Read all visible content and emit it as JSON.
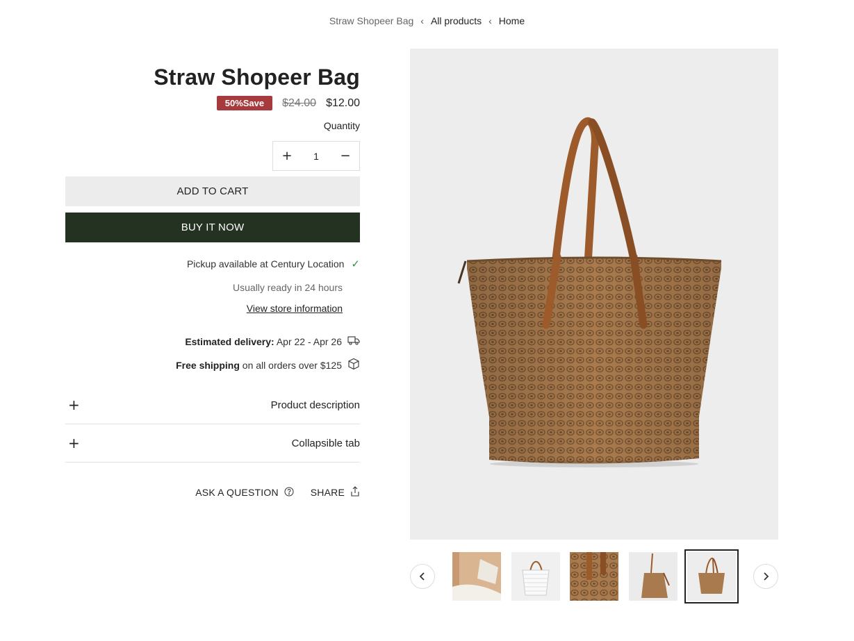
{
  "breadcrumb": {
    "current": "Straw Shopeer Bag",
    "items": [
      "All products",
      "Home"
    ],
    "separator": "‹"
  },
  "product": {
    "title": "Straw Shopeer Bag",
    "badge": "50%Save",
    "price_old": "$24.00",
    "price_new": "$12.00"
  },
  "quantity": {
    "label": "Quantity",
    "value": "1",
    "plus": "+",
    "minus": "−"
  },
  "buttons": {
    "add_to_cart": "ADD TO CART",
    "buy_now": "BUY IT NOW"
  },
  "pickup": {
    "text": "Pickup available at Century Location",
    "ready": "Usually ready in 24 hours",
    "link": "View store information"
  },
  "delivery": {
    "label": "Estimated delivery:",
    "range": "Apr 22 - Apr 26"
  },
  "shipping": {
    "label": "Free shipping",
    "text": "on all orders over $125"
  },
  "accordion": [
    {
      "label": "Product description",
      "icon": "+"
    },
    {
      "label": "Collapsible tab",
      "icon": "+"
    }
  ],
  "actions": {
    "ask": "ASK A QUESTION",
    "share": "SHARE"
  },
  "colors": {
    "badge": "#a73a3d",
    "buy_button": "#243321",
    "cart_button": "#ececec",
    "check": "#3b8a43",
    "straw": "#a87a4e",
    "leather": "#9d5a2a"
  },
  "gallery": {
    "thumbnails": [
      "interior-view",
      "white-variant",
      "closeup-detail",
      "side-view",
      "front-view"
    ],
    "active_index": 4
  }
}
